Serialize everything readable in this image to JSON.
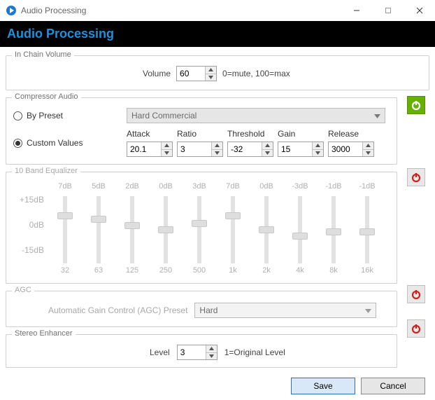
{
  "window": {
    "title": "Audio Processing",
    "header": "Audio Processing"
  },
  "volume": {
    "group": "In Chain Volume",
    "label": "Volume",
    "value": "60",
    "hint": "0=mute, 100=max"
  },
  "compressor": {
    "group": "Compressor Audio",
    "radio_preset": "By Preset",
    "radio_custom": "Custom Values",
    "preset": "Hard Commercial",
    "labels": {
      "attack": "Attack",
      "ratio": "Ratio",
      "threshold": "Threshold",
      "gain": "Gain",
      "release": "Release"
    },
    "values": {
      "attack": "20.1",
      "ratio": "3",
      "threshold": "-32",
      "gain": "15",
      "release": "3000"
    }
  },
  "eq": {
    "group": "10 Band Equalizer",
    "ylabels": {
      "top": "+15dB",
      "mid": "0dB",
      "bot": "-15dB"
    },
    "bands": [
      {
        "db": "7dB",
        "freq": "32",
        "pos": 27
      },
      {
        "db": "5dB",
        "freq": "63",
        "pos": 33
      },
      {
        "db": "2dB",
        "freq": "125",
        "pos": 43
      },
      {
        "db": "0dB",
        "freq": "250",
        "pos": 50
      },
      {
        "db": "3dB",
        "freq": "500",
        "pos": 40
      },
      {
        "db": "7dB",
        "freq": "1k",
        "pos": 27
      },
      {
        "db": "0dB",
        "freq": "2k",
        "pos": 50
      },
      {
        "db": "-3dB",
        "freq": "4k",
        "pos": 60
      },
      {
        "db": "-1dB",
        "freq": "8k",
        "pos": 53
      },
      {
        "db": "-1dB",
        "freq": "16k",
        "pos": 53
      }
    ]
  },
  "agc": {
    "group": "AGC",
    "label": "Automatic Gain Control (AGC) Preset",
    "preset": "Hard"
  },
  "enhancer": {
    "group": "Stereo Enhancer",
    "label": "Level",
    "value": "3",
    "hint": "1=Original Level"
  },
  "footer": {
    "save": "Save",
    "cancel": "Cancel"
  }
}
